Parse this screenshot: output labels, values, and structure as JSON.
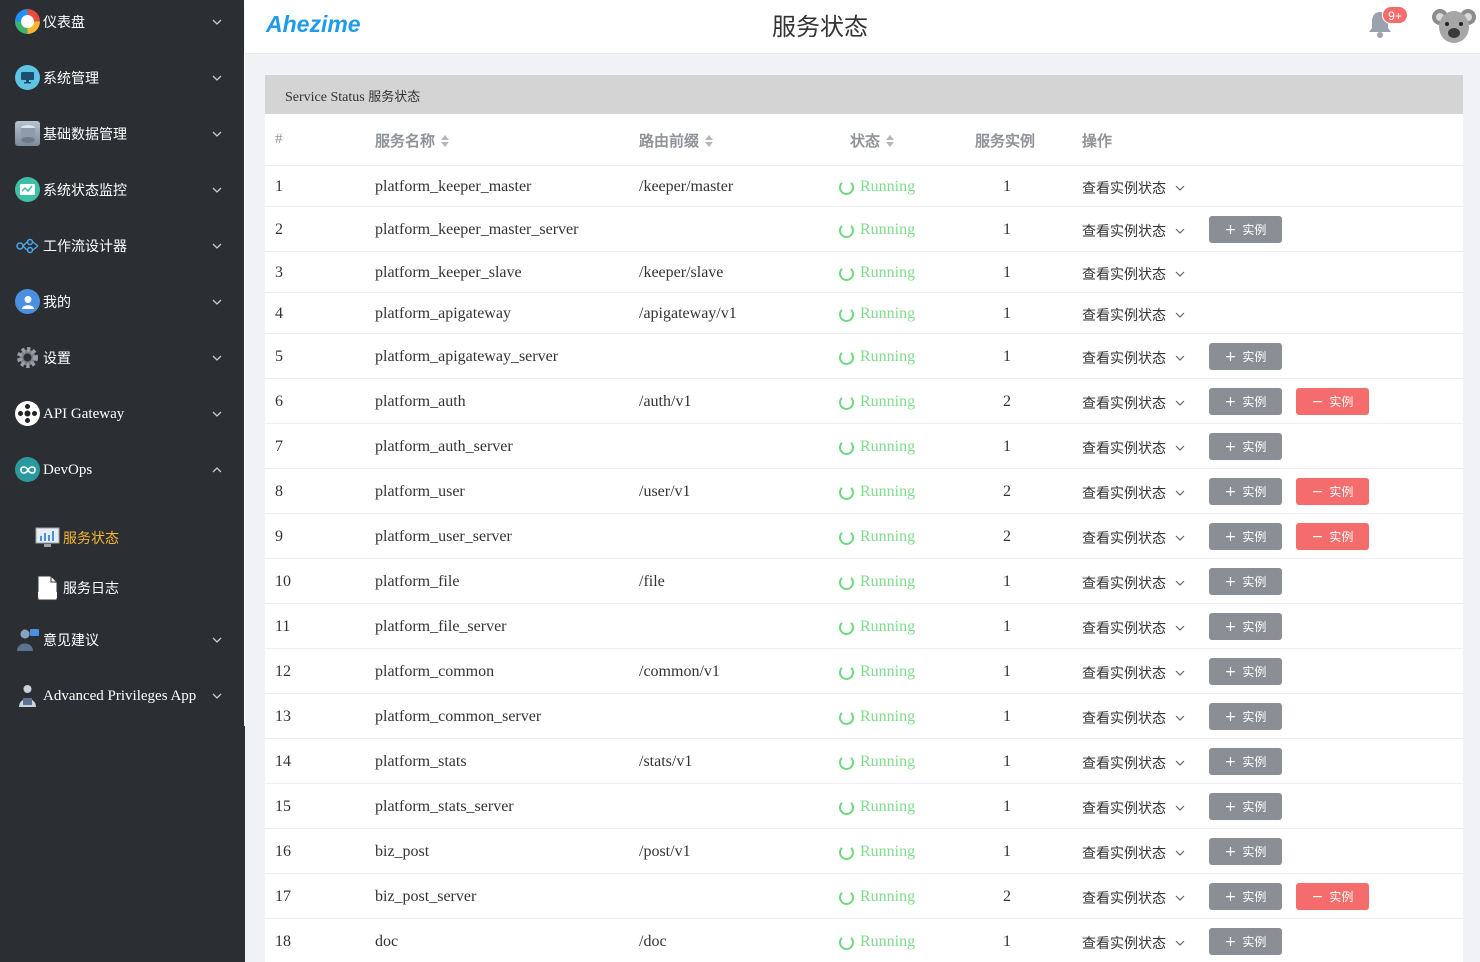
{
  "app": {
    "logo": "Ahezime",
    "page_title": "服务状态",
    "notification_badge": "9+"
  },
  "sidebar": {
    "items": [
      {
        "label": "仪表盘",
        "icon": "dashboard-icon",
        "expanded": false
      },
      {
        "label": "系统管理",
        "icon": "monitor-icon",
        "expanded": false
      },
      {
        "label": "基础数据管理",
        "icon": "database-icon",
        "expanded": false
      },
      {
        "label": "系统状态监控",
        "icon": "status-monitor-icon",
        "expanded": false
      },
      {
        "label": "工作流设计器",
        "icon": "workflow-icon",
        "expanded": false
      },
      {
        "label": "我的",
        "icon": "user-icon",
        "expanded": false
      },
      {
        "label": "设置",
        "icon": "gear-icon",
        "expanded": false
      },
      {
        "label": "API Gateway",
        "icon": "api-gateway-icon",
        "expanded": false
      },
      {
        "label": "DevOps",
        "icon": "devops-icon",
        "expanded": true
      },
      {
        "label": "意见建议",
        "icon": "feedback-icon",
        "expanded": false
      },
      {
        "label": "Advanced Privileges App",
        "icon": "privileges-icon",
        "expanded": false
      }
    ],
    "devops_children": [
      {
        "label": "服务状态",
        "icon": "chart-screen-icon",
        "active": true
      },
      {
        "label": "服务日志",
        "icon": "log-file-icon",
        "active": false
      }
    ]
  },
  "panel": {
    "title_en": "Service Status",
    "title_cn": "服务状态"
  },
  "table": {
    "headers": {
      "index": "#",
      "name": "服务名称",
      "route": "路由前缀",
      "status": "状态",
      "instances": "服务实例",
      "actions": "操作"
    },
    "view_label": "查看实例状态",
    "add_label": "实例",
    "remove_label": "实例",
    "rows": [
      {
        "index": "1",
        "name": "platform_keeper_master",
        "route": "/keeper/master",
        "status": "Running",
        "count": "1",
        "add": false,
        "remove": false
      },
      {
        "index": "2",
        "name": "platform_keeper_master_server",
        "route": "",
        "status": "Running",
        "count": "1",
        "add": true,
        "remove": false
      },
      {
        "index": "3",
        "name": "platform_keeper_slave",
        "route": "/keeper/slave",
        "status": "Running",
        "count": "1",
        "add": false,
        "remove": false
      },
      {
        "index": "4",
        "name": "platform_apigateway",
        "route": "/apigateway/v1",
        "status": "Running",
        "count": "1",
        "add": false,
        "remove": false
      },
      {
        "index": "5",
        "name": "platform_apigateway_server",
        "route": "",
        "status": "Running",
        "count": "1",
        "add": true,
        "remove": false
      },
      {
        "index": "6",
        "name": "platform_auth",
        "route": "/auth/v1",
        "status": "Running",
        "count": "2",
        "add": true,
        "remove": true
      },
      {
        "index": "7",
        "name": "platform_auth_server",
        "route": "",
        "status": "Running",
        "count": "1",
        "add": true,
        "remove": false
      },
      {
        "index": "8",
        "name": "platform_user",
        "route": "/user/v1",
        "status": "Running",
        "count": "2",
        "add": true,
        "remove": true
      },
      {
        "index": "9",
        "name": "platform_user_server",
        "route": "",
        "status": "Running",
        "count": "2",
        "add": true,
        "remove": true
      },
      {
        "index": "10",
        "name": "platform_file",
        "route": "/file",
        "status": "Running",
        "count": "1",
        "add": true,
        "remove": false
      },
      {
        "index": "11",
        "name": "platform_file_server",
        "route": "",
        "status": "Running",
        "count": "1",
        "add": true,
        "remove": false
      },
      {
        "index": "12",
        "name": "platform_common",
        "route": "/common/v1",
        "status": "Running",
        "count": "1",
        "add": true,
        "remove": false
      },
      {
        "index": "13",
        "name": "platform_common_server",
        "route": "",
        "status": "Running",
        "count": "1",
        "add": true,
        "remove": false
      },
      {
        "index": "14",
        "name": "platform_stats",
        "route": "/stats/v1",
        "status": "Running",
        "count": "1",
        "add": true,
        "remove": false
      },
      {
        "index": "15",
        "name": "platform_stats_server",
        "route": "",
        "status": "Running",
        "count": "1",
        "add": true,
        "remove": false
      },
      {
        "index": "16",
        "name": "biz_post",
        "route": "/post/v1",
        "status": "Running",
        "count": "1",
        "add": true,
        "remove": false
      },
      {
        "index": "17",
        "name": "biz_post_server",
        "route": "",
        "status": "Running",
        "count": "2",
        "add": true,
        "remove": true
      },
      {
        "index": "18",
        "name": "doc",
        "route": "/doc",
        "status": "Running",
        "count": "1",
        "add": true,
        "remove": false
      }
    ]
  },
  "colors": {
    "sidebar_bg": "#2b2f33",
    "active_menu": "#f5b731",
    "running_green": "#7fdc8c",
    "add_button": "#8b8e94",
    "remove_button": "#f56c6c",
    "logo_blue": "#1e9be8"
  }
}
